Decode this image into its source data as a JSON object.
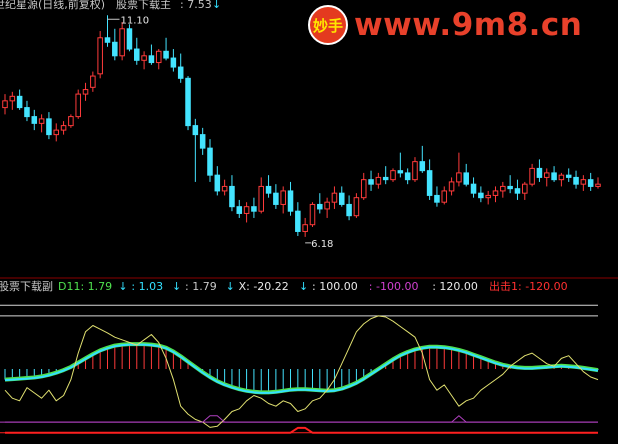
{
  "chart_data": [
    {
      "type": "candlestick",
      "panel": "main",
      "title_prefix": "世纪星源(日线,前复权)",
      "indicator_label": "股票下载主",
      "indicator_value": ": 7.53",
      "annotations": {
        "high": "11.10",
        "low": "6.18"
      },
      "colors": {
        "up": "#ff3b3b",
        "down": "#44e4ff",
        "flat": "#ffffff",
        "background": "#000000"
      },
      "ylim": [
        5.4,
        11.35
      ],
      "candles": [
        [
          9.05,
          9.35,
          8.9,
          9.2
        ],
        [
          9.2,
          9.4,
          9.0,
          9.3
        ],
        [
          9.3,
          9.45,
          9.0,
          9.05
        ],
        [
          9.05,
          9.2,
          8.75,
          8.85
        ],
        [
          8.85,
          9.0,
          8.55,
          8.7
        ],
        [
          8.7,
          8.9,
          8.5,
          8.8
        ],
        [
          8.8,
          8.95,
          8.35,
          8.45
        ],
        [
          8.45,
          8.7,
          8.3,
          8.55
        ],
        [
          8.55,
          8.75,
          8.45,
          8.65
        ],
        [
          8.65,
          8.9,
          8.6,
          8.85
        ],
        [
          8.85,
          9.45,
          8.8,
          9.35
        ],
        [
          9.35,
          9.6,
          9.2,
          9.45
        ],
        [
          9.5,
          9.85,
          9.4,
          9.75
        ],
        [
          9.8,
          10.75,
          9.7,
          10.6
        ],
        [
          10.6,
          11.1,
          10.4,
          10.5
        ],
        [
          10.5,
          10.8,
          10.1,
          10.2
        ],
        [
          10.2,
          10.95,
          10.1,
          10.8
        ],
        [
          10.8,
          10.9,
          10.3,
          10.35
        ],
        [
          10.35,
          10.6,
          10.0,
          10.1
        ],
        [
          10.1,
          10.3,
          9.9,
          10.2
        ],
        [
          10.2,
          10.45,
          10.0,
          10.05
        ],
        [
          10.05,
          10.35,
          9.9,
          10.3
        ],
        [
          10.3,
          10.6,
          10.1,
          10.15
        ],
        [
          10.15,
          10.35,
          9.85,
          9.95
        ],
        [
          9.95,
          10.25,
          9.6,
          9.7
        ],
        [
          9.7,
          9.75,
          8.55,
          8.65
        ],
        [
          8.65,
          8.8,
          7.4,
          8.45
        ],
        [
          8.45,
          8.6,
          8.0,
          8.15
        ],
        [
          8.15,
          8.35,
          7.4,
          7.55
        ],
        [
          7.55,
          7.75,
          7.1,
          7.2
        ],
        [
          7.2,
          7.45,
          7.1,
          7.3
        ],
        [
          7.3,
          7.55,
          6.75,
          6.85
        ],
        [
          6.85,
          7.0,
          6.6,
          6.7
        ],
        [
          6.7,
          6.95,
          6.5,
          6.85
        ],
        [
          6.85,
          7.05,
          6.6,
          6.75
        ],
        [
          6.75,
          7.5,
          6.7,
          7.3
        ],
        [
          7.3,
          7.55,
          7.05,
          7.15
        ],
        [
          7.15,
          7.35,
          6.8,
          6.9
        ],
        [
          6.9,
          7.3,
          6.7,
          7.2
        ],
        [
          7.2,
          7.4,
          6.65,
          6.75
        ],
        [
          6.75,
          6.95,
          6.2,
          6.3
        ],
        [
          6.3,
          6.6,
          6.18,
          6.45
        ],
        [
          6.45,
          6.95,
          6.4,
          6.9
        ],
        [
          6.9,
          7.15,
          6.7,
          6.8
        ],
        [
          6.8,
          7.05,
          6.6,
          6.95
        ],
        [
          6.95,
          7.3,
          6.8,
          7.15
        ],
        [
          7.15,
          7.3,
          6.85,
          6.9
        ],
        [
          6.9,
          7.1,
          6.55,
          6.65
        ],
        [
          6.65,
          7.15,
          6.6,
          7.05
        ],
        [
          7.05,
          7.6,
          7.0,
          7.45
        ],
        [
          7.45,
          7.65,
          7.2,
          7.35
        ],
        [
          7.35,
          7.6,
          7.25,
          7.5
        ],
        [
          7.5,
          7.75,
          7.35,
          7.45
        ],
        [
          7.45,
          7.7,
          7.4,
          7.65
        ],
        [
          7.65,
          8.05,
          7.5,
          7.6
        ],
        [
          7.6,
          7.7,
          7.35,
          7.45
        ],
        [
          7.45,
          7.95,
          7.4,
          7.85
        ],
        [
          7.85,
          8.2,
          7.6,
          7.65
        ],
        [
          7.65,
          7.9,
          7.0,
          7.1
        ],
        [
          7.1,
          7.3,
          6.85,
          6.95
        ],
        [
          6.95,
          7.3,
          6.9,
          7.2
        ],
        [
          7.2,
          7.5,
          7.1,
          7.4
        ],
        [
          7.4,
          8.05,
          7.3,
          7.6
        ],
        [
          7.6,
          7.8,
          7.3,
          7.35
        ],
        [
          7.35,
          7.5,
          7.05,
          7.15
        ],
        [
          7.15,
          7.3,
          6.95,
          7.05
        ],
        [
          7.05,
          7.2,
          6.9,
          7.1
        ],
        [
          7.1,
          7.3,
          6.95,
          7.2
        ],
        [
          7.2,
          7.4,
          7.05,
          7.3
        ],
        [
          7.3,
          7.55,
          7.15,
          7.25
        ],
        [
          7.25,
          7.45,
          7.0,
          7.15
        ],
        [
          7.15,
          7.4,
          7.0,
          7.35
        ],
        [
          7.35,
          7.8,
          7.3,
          7.7
        ],
        [
          7.7,
          7.9,
          7.4,
          7.5
        ],
        [
          7.5,
          7.7,
          7.3,
          7.6
        ],
        [
          7.6,
          7.75,
          7.4,
          7.45
        ],
        [
          7.45,
          7.6,
          7.3,
          7.55
        ],
        [
          7.55,
          7.7,
          7.4,
          7.5
        ],
        [
          7.5,
          7.65,
          7.25,
          7.35
        ],
        [
          7.35,
          7.55,
          7.2,
          7.45
        ],
        [
          7.45,
          7.6,
          7.2,
          7.3
        ],
        [
          7.3,
          7.5,
          7.25,
          7.35
        ]
      ]
    },
    {
      "type": "line",
      "panel": "sub",
      "title": "股票下载副",
      "ylim": [
        -130,
        130
      ],
      "legend": [
        {
          "label": "D11: 1.79",
          "arrow": "↓",
          "color": "#4fe04f"
        },
        {
          "label": ": 1.03",
          "arrow": "↓",
          "color": "#33e0ff"
        },
        {
          "label": ": 1.79",
          "arrow": "↓",
          "color": "#c8c8c8"
        },
        {
          "label": "X: -20.22",
          "arrow": "↓",
          "color": "#e8e8e8"
        },
        {
          "label": ": 100.00",
          "arrow": "",
          "color": "#e8e8e8"
        },
        {
          "label": ": -100.00",
          "arrow": "",
          "color": "#d040d0"
        },
        {
          "label": ": 120.00",
          "arrow": "",
          "color": "#e8e8e8"
        },
        {
          "label": "出击1: -120.00",
          "arrow": "",
          "color": "#ff3030"
        }
      ],
      "reference_lines": [
        120,
        100,
        -100,
        -120
      ],
      "series": [
        {
          "name": "D11",
          "color": "#4fe04f",
          "values": [
            -20,
            -19,
            -18,
            -17,
            -16,
            -14,
            -11,
            -7,
            -2,
            4,
            12,
            20,
            28,
            35,
            40,
            44,
            46,
            47,
            47,
            47,
            46,
            44,
            40,
            33,
            24,
            14,
            4,
            -6,
            -15,
            -23,
            -29,
            -34,
            -38,
            -41,
            -43,
            -44,
            -44,
            -43,
            -41,
            -39,
            -38,
            -38,
            -39,
            -40,
            -41,
            -40,
            -37,
            -32,
            -26,
            -18,
            -9,
            0,
            9,
            18,
            26,
            32,
            37,
            40,
            42,
            42,
            41,
            39,
            36,
            32,
            27,
            22,
            17,
            12,
            8,
            5,
            3,
            2,
            2,
            3,
            4,
            5,
            6,
            5,
            4,
            2,
            0,
            -2
          ]
        },
        {
          "name": "",
          "color": "#33e0ff",
          "values": [
            -21,
            -20,
            -19,
            -18,
            -17,
            -15,
            -12,
            -8,
            -3,
            3,
            11,
            19,
            27,
            34,
            39,
            43,
            45,
            46,
            46,
            46,
            45,
            43,
            39,
            32,
            23,
            13,
            3,
            -7,
            -16,
            -24,
            -30,
            -35,
            -39,
            -42,
            -44,
            -45,
            -45,
            -44,
            -42,
            -40,
            -39,
            -39,
            -40,
            -41,
            -42,
            -41,
            -38,
            -33,
            -27,
            -19,
            -10,
            -1,
            8,
            17,
            25,
            31,
            36,
            39,
            41,
            41,
            40,
            38,
            35,
            31,
            26,
            21,
            16,
            11,
            7,
            4,
            2,
            1,
            1,
            2,
            3,
            4,
            5,
            4,
            3,
            1,
            -1,
            -3
          ]
        },
        {
          "name": "",
          "color": "#e0e070",
          "values": [
            -40,
            -55,
            -60,
            -35,
            -45,
            -55,
            -40,
            -60,
            -50,
            -20,
            30,
            70,
            82,
            75,
            68,
            60,
            55,
            50,
            45,
            55,
            65,
            50,
            20,
            -20,
            -70,
            -85,
            -95,
            -100,
            -110,
            -108,
            -95,
            -80,
            -75,
            -60,
            -50,
            -55,
            -65,
            -70,
            -60,
            -65,
            -80,
            -75,
            -60,
            -55,
            -40,
            -20,
            10,
            40,
            70,
            85,
            95,
            100,
            98,
            90,
            80,
            70,
            60,
            30,
            -20,
            -40,
            -30,
            -50,
            -70,
            -60,
            -55,
            -40,
            -30,
            -20,
            -10,
            5,
            15,
            25,
            30,
            20,
            10,
            5,
            20,
            25,
            10,
            -5,
            -15,
            -20
          ]
        },
        {
          "name": "",
          "color": "#b040c0",
          "values": [
            -100,
            -100,
            -100,
            -100,
            -100,
            -100,
            -100,
            -100,
            -100,
            -100,
            -100,
            -100,
            -100,
            -100,
            -100,
            -100,
            -100,
            -100,
            -100,
            -100,
            -100,
            -100,
            -100,
            -100,
            -100,
            -100,
            -100,
            -100,
            -88,
            -88,
            -100,
            -100,
            -100,
            -100,
            -100,
            -100,
            -100,
            -100,
            -100,
            -100,
            -100,
            -100,
            -100,
            -100,
            -100,
            -100,
            -100,
            -100,
            -100,
            -100,
            -100,
            -100,
            -100,
            -100,
            -100,
            -100,
            -100,
            -100,
            -100,
            -100,
            -100,
            -100,
            -88,
            -100,
            -100,
            -100,
            -100,
            -100,
            -100,
            -100,
            -100,
            -100,
            -100,
            -100,
            -100,
            -100,
            -100,
            -100,
            -100,
            -100,
            -100,
            -100
          ]
        },
        {
          "name": "",
          "color": "#ff2020",
          "values": [
            -120,
            -120,
            -120,
            -120,
            -120,
            -120,
            -120,
            -120,
            -120,
            -120,
            -120,
            -120,
            -120,
            -120,
            -120,
            -120,
            -120,
            -120,
            -120,
            -120,
            -120,
            -120,
            -120,
            -120,
            -120,
            -120,
            -120,
            -120,
            -120,
            -120,
            -120,
            -120,
            -120,
            -120,
            -120,
            -120,
            -120,
            -120,
            -120,
            -120,
            -111,
            -111,
            -120,
            -120,
            -120,
            -120,
            -120,
            -120,
            -120,
            -120,
            -120,
            -120,
            -120,
            -120,
            -120,
            -120,
            -120,
            -120,
            -120,
            -120,
            -120,
            -120,
            -120,
            -120,
            -120,
            -120,
            -120,
            -120,
            -120,
            -120,
            -120,
            -120,
            -120,
            -120,
            -120,
            -120,
            -120,
            -120,
            -120,
            -120,
            -120,
            -120
          ]
        }
      ]
    }
  ],
  "watermark": {
    "badge": "妙手",
    "text": "www.9m8.cn"
  }
}
